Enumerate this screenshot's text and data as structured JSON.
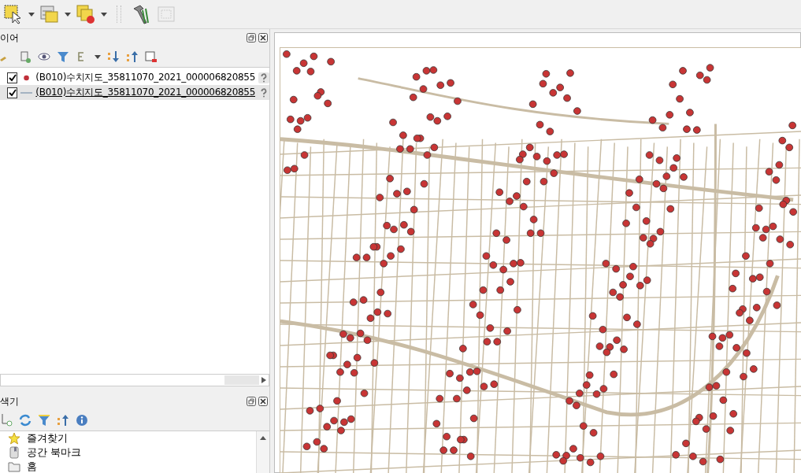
{
  "toolbar": {
    "tools": [
      {
        "kind": "select",
        "menu": true
      },
      {
        "kind": "table",
        "menu": true
      },
      {
        "kind": "deselect",
        "menu": true
      },
      {
        "kind": "sep"
      },
      {
        "kind": "build",
        "menu": false
      },
      {
        "kind": "layout",
        "menu": false,
        "disabled": true
      }
    ]
  },
  "layers_panel": {
    "title": "이어",
    "layers": [
      {
        "name": "(B010)수치지도_35811070_2021_000006820855",
        "kind": "point",
        "checked": true,
        "selected": false,
        "underlined": false
      },
      {
        "name": "(B010)수치지도_35811070_2021_000006820855",
        "kind": "line",
        "checked": true,
        "selected": true,
        "underlined": true
      }
    ]
  },
  "browser_panel": {
    "title": "색기",
    "items": [
      {
        "label": "즐겨찾기",
        "kind": "star"
      },
      {
        "label": "공간 북마크",
        "kind": "bookmark"
      },
      {
        "label": "홈",
        "kind": "folder"
      }
    ]
  }
}
